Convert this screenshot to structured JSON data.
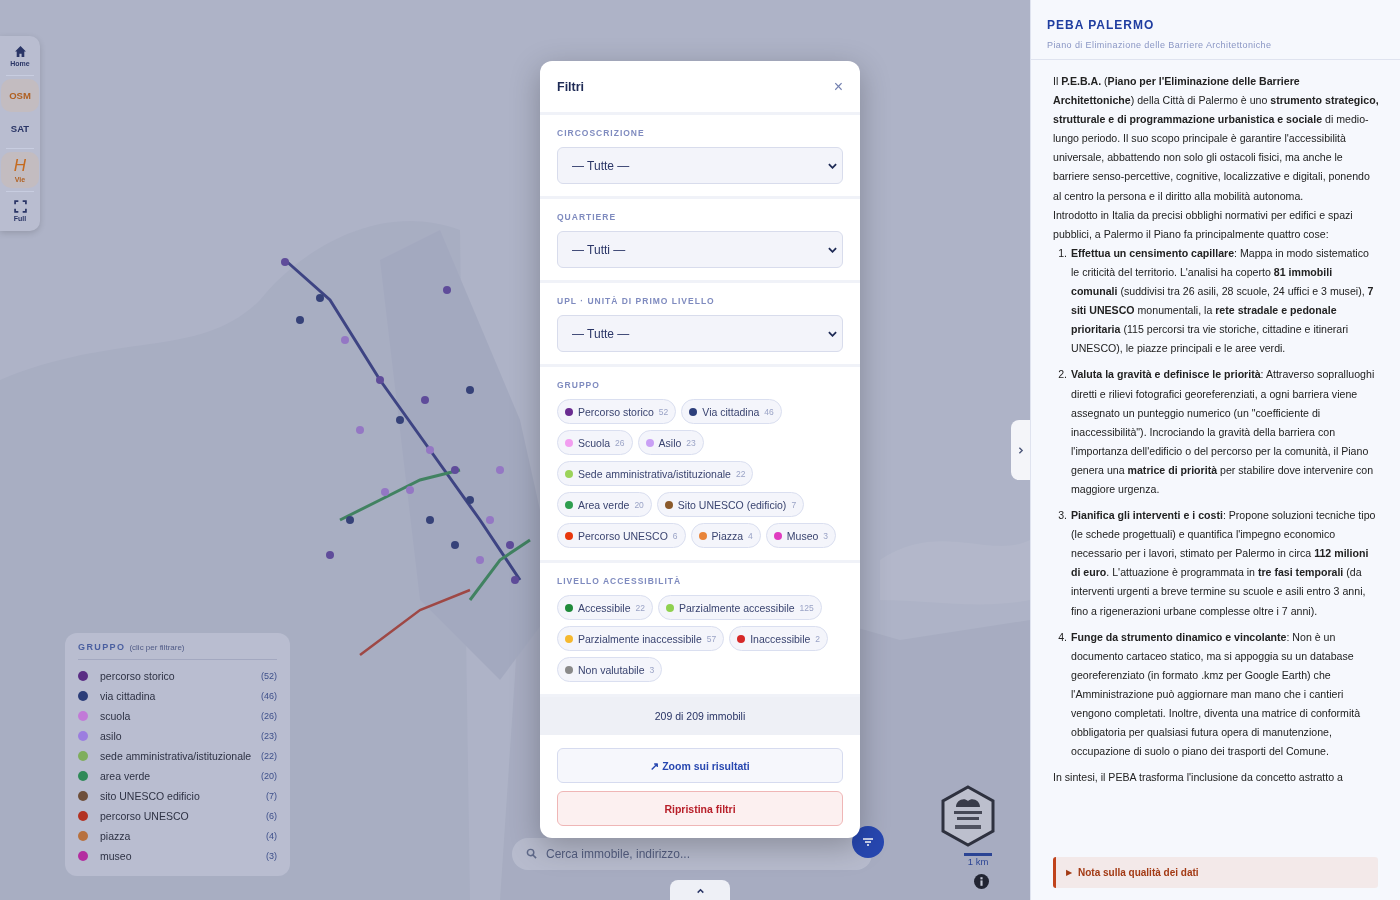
{
  "toolbar": [
    {
      "kind": "home",
      "label": "Home",
      "active": false
    },
    {
      "kind": "base",
      "label": "OSM",
      "active": true
    },
    {
      "kind": "base",
      "label": "SAT",
      "active": false
    },
    {
      "kind": "layer",
      "glyph": "H",
      "label": "Vie",
      "active": true
    },
    {
      "kind": "fullscreen",
      "label": "Full",
      "active": false
    }
  ],
  "legend": {
    "title": "GRUPPO",
    "hint": "(clic per filtrare)",
    "items": [
      {
        "label": "percorso storico",
        "count": "(52)",
        "color": "#5a2d84"
      },
      {
        "label": "via cittadina",
        "count": "(46)",
        "color": "#2b3d78"
      },
      {
        "label": "scuola",
        "count": "(26)",
        "color": "#c27ad8"
      },
      {
        "label": "asilo",
        "count": "(23)",
        "color": "#9c7ee0"
      },
      {
        "label": "sede amministrativa/istituzionale",
        "count": "(22)",
        "color": "#7fae5c"
      },
      {
        "label": "area verde",
        "count": "(20)",
        "color": "#2f8a58"
      },
      {
        "label": "sito UNESCO edificio",
        "count": "(7)",
        "color": "#6e4f3a"
      },
      {
        "label": "percorso UNESCO",
        "count": "(6)",
        "color": "#b33222"
      },
      {
        "label": "piazza",
        "count": "(4)",
        "color": "#b8713e"
      },
      {
        "label": "museo",
        "count": "(3)",
        "color": "#b42da0"
      }
    ]
  },
  "search": {
    "placeholder": "Cerca immobile, indirizzo..."
  },
  "scale": "1 km",
  "filters": {
    "title": "Filtri",
    "close": "×",
    "selects": [
      {
        "label": "CIRCOSCRIZIONE",
        "value": "— Tutte —"
      },
      {
        "label": "QUARTIERE",
        "value": "— Tutti —"
      },
      {
        "label": "UPL · UNITÀ DI PRIMO LIVELLO",
        "value": "— Tutte —"
      }
    ],
    "groups": [
      {
        "title": "GRUPPO",
        "chips": [
          {
            "label": "Percorso storico",
            "count": "52",
            "color": "#6a2c91"
          },
          {
            "label": "Via cittadina",
            "count": "46",
            "color": "#2d3f7b"
          },
          {
            "label": "Scuola",
            "count": "26",
            "color": "#f29ef0"
          },
          {
            "label": "Asilo",
            "count": "23",
            "color": "#c9a0f5"
          },
          {
            "label": "Sede amministrativa/istituzionale",
            "count": "22",
            "color": "#9bd35a"
          },
          {
            "label": "Area verde",
            "count": "20",
            "color": "#2e9e4f"
          },
          {
            "label": "Sito UNESCO (edificio)",
            "count": "7",
            "color": "#8b5a2b"
          },
          {
            "label": "Percorso UNESCO",
            "count": "6",
            "color": "#e8380d"
          },
          {
            "label": "Piazza",
            "count": "4",
            "color": "#e8843a"
          },
          {
            "label": "Museo",
            "count": "3",
            "color": "#e03cc0"
          }
        ]
      },
      {
        "title": "LIVELLO ACCESSIBILITÀ",
        "chips": [
          {
            "label": "Accessibile",
            "count": "22",
            "color": "#1f8a3a"
          },
          {
            "label": "Parzialmente accessibile",
            "count": "125",
            "color": "#8fd14f"
          },
          {
            "label": "Parzialmente inaccessibile",
            "count": "57",
            "color": "#f5b82e"
          },
          {
            "label": "Inaccessibile",
            "count": "2",
            "color": "#d62828"
          },
          {
            "label": "Non valutabile",
            "count": "3",
            "color": "#8a8a8a"
          }
        ]
      }
    ],
    "summary": "209 di 209 immobili",
    "zoom_button": "↗ Zoom sui risultati",
    "reset_button": "Ripristina filtri"
  },
  "info_panel": {
    "title": "PEBA PALERMO",
    "subtitle": "Piano di Eliminazione delle Barriere Architettoniche",
    "paragraphs": [
      "Il **P.E.B.A.** (**Piano per l'Eliminazione delle Barriere Architettoniche**) della Città di Palermo è uno **strumento strategico, strutturale e di programmazione urbanistica e sociale** di medio-lungo periodo. Il suo scopo principale è garantire l'accessibilità universale, abbattendo non solo gli ostacoli fisici, ma anche le barriere senso-percettive, cognitive, localizzative e digitali, ponendo al centro la persona e il diritto alla mobilità autonoma.",
      "Introdotto in Italia da precisi obblighi normativi per edifici e spazi pubblici, a Palermo il Piano fa principalmente quattro cose:"
    ],
    "list": [
      {
        "number": "1.",
        "text": "**Effettua un censimento capillare**: Mappa in modo sistematico le criticità del territorio. L'analisi ha coperto **81 immobili comunali** (suddivisi tra 26 asili, 28 scuole, 24 uffici e 3 musei), **7 siti UNESCO** monumentali, la **rete stradale e pedonale prioritaria** (115 percorsi tra vie storiche, cittadine e itinerari UNESCO), le piazze principali e le aree verdi."
      },
      {
        "number": "2.",
        "text": "**Valuta la gravità e definisce le priorità**: Attraverso sopralluoghi diretti e rilievi fotografici georeferenziati, a ogni barriera viene assegnato un punteggio numerico (un \"coefficiente di inaccessibilità\"). Incrociando la gravità della barriera con l'importanza dell'edificio o del percorso per la comunità, il Piano genera una **matrice di priorità** per stabilire dove intervenire con maggiore urgenza."
      },
      {
        "number": "3.",
        "text": "**Pianifica gli interventi e i costi**: Propone soluzioni tecniche tipo (le schede progettuali) e quantifica l'impegno economico necessario per i lavori, stimato per Palermo in circa **112 milioni di euro**. L'attuazione è programmata in **tre fasi temporali** (da interventi urgenti a breve termine su scuole e asili entro 3 anni, fino a rigenerazioni urbane complesse oltre i 7 anni)."
      },
      {
        "number": "4.",
        "text": "**Funge da strumento dinamico e vincolante**: Non è un documento cartaceo statico, ma si appoggia su un database georeferenziato (in formato .kmz per Google Earth) che l'Amministrazione può aggiornare man mano che i cantieri vengono completati. Inoltre, diventa una matrice di conformità obbligatoria per qualsiasi futura opera di manutenzione, occupazione di suolo o piano dei trasporti del Comune."
      }
    ],
    "closing": "In sintesi, il PEBA trasforma l'inclusione da concetto astratto a",
    "note": {
      "marker": "▶",
      "label": "Nota sulla qualità dei dati"
    }
  }
}
